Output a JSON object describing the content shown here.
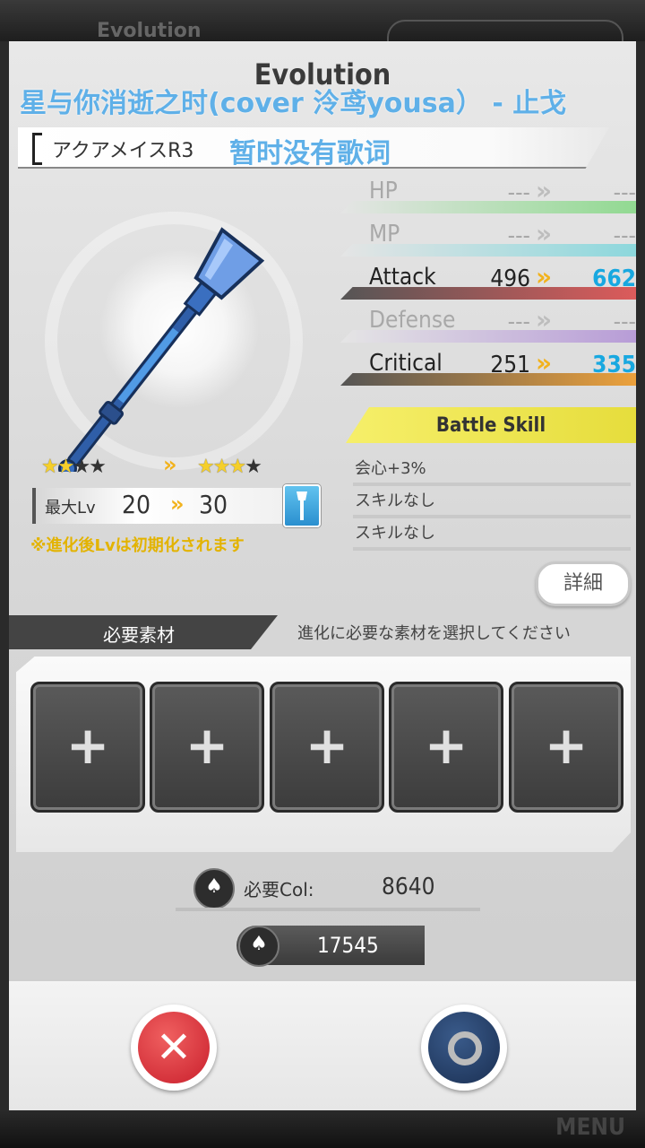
{
  "dialog": {
    "title": "Evolution",
    "lyric_line1": "星与你消逝之时(cover 泠鸢yousa） - 止戈",
    "lyric_line2": "暂时没有歌词",
    "item_name": "アクアメイスR3"
  },
  "stats": [
    {
      "label": "HP",
      "before": "---",
      "after": "---",
      "active": false,
      "color": "#8fd98f"
    },
    {
      "label": "MP",
      "before": "---",
      "after": "---",
      "active": false,
      "color": "#8ad7dc"
    },
    {
      "label": "Attack",
      "before": "496",
      "after": "662",
      "active": true,
      "color": "#e05b5b"
    },
    {
      "label": "Defense",
      "before": "---",
      "after": "---",
      "active": false,
      "color": "#b69ad6"
    },
    {
      "label": "Critical",
      "before": "251",
      "after": "335",
      "active": true,
      "color": "#f0a33b"
    }
  ],
  "arrow_glyph": "»",
  "rarity": {
    "before_filled": "★★",
    "before_empty": "★★",
    "after_filled": "★★★",
    "after_empty": "★"
  },
  "level": {
    "label": "最大Lv",
    "before": "20",
    "after": "30",
    "note": "※進化後Lvは初期化されます"
  },
  "battle_skill": {
    "header": "Battle Skill",
    "items": [
      "会心+3%",
      "スキルなし",
      "スキルなし"
    ],
    "details_label": "詳細"
  },
  "materials": {
    "header": "必要素材",
    "hint": "進化に必要な素材を選択してください",
    "slot_glyph": "+"
  },
  "cost": {
    "label": "必要Col:",
    "value": "8640",
    "owned": "17545",
    "icon": "money-bag-icon"
  },
  "buttons": {
    "cancel_glyph": "✕",
    "ok_icon": "circle-icon"
  },
  "background": {
    "ghost_title": "Evolution",
    "menu": "MENU"
  }
}
